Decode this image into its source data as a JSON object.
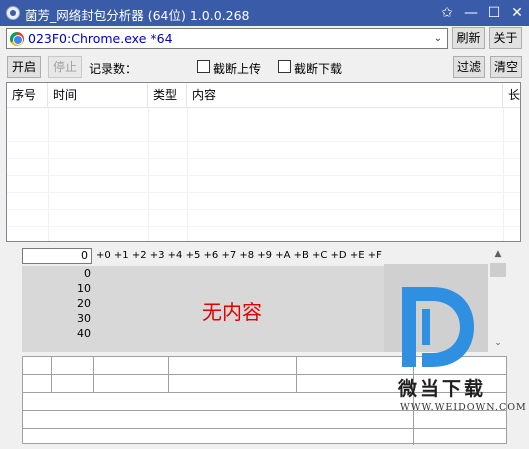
{
  "window": {
    "title": "菌芳_网络封包分析器 (64位) 1.0.0.268",
    "pin_glyph": "✩",
    "minimize_glyph": "—",
    "maximize_glyph": "☐",
    "close_glyph": "✕"
  },
  "process": {
    "selected": "023F0:Chrome.exe *64",
    "dropdown_glyph": "⌄"
  },
  "toolbar": {
    "refresh": "刷新",
    "about": "关于",
    "start": "开启",
    "stop": "停止",
    "record_count_label": "记录数：",
    "cut_upload": "截断上传",
    "cut_download": "截断下载",
    "filter": "过滤",
    "clear": "清空"
  },
  "packet_list": {
    "columns": [
      "序号",
      "时间",
      "类型",
      "内容",
      "长"
    ]
  },
  "hex_view": {
    "offset_value": "0",
    "column_headers": "+0 +1 +2 +3 +4 +5 +6 +7 +8 +9 +A +B +C +D +E +F",
    "row_offsets": [
      "0",
      "10",
      "20",
      "30",
      "40"
    ],
    "empty_message": "无内容",
    "scroll_up": "▲",
    "scroll_down": "⌄"
  },
  "watermark": {
    "name": "微当下载",
    "url": "WWW.WEIDOWN.COM",
    "logo_color": "#2f8fe0"
  },
  "colors": {
    "titlebar": "#3a5ba8",
    "process_text": "#0000c0",
    "empty_message": "#e00000"
  }
}
